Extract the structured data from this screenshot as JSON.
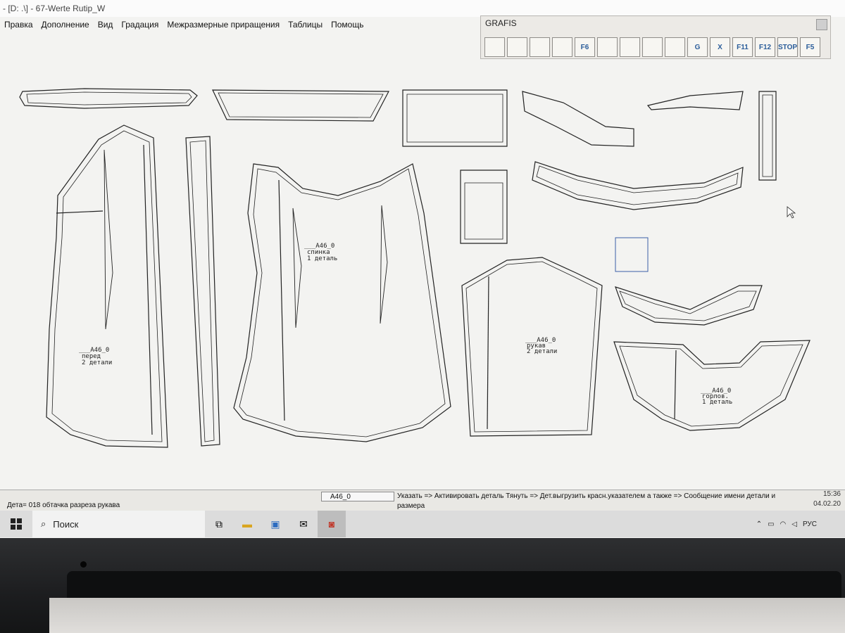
{
  "window": {
    "title": "- [D: .\\] - 67-Werte Rutip_W"
  },
  "menu": [
    "Правка",
    "Дополнение",
    "Вид",
    "Градация",
    "Межразмерные приращения",
    "Таблицы",
    "Помощь"
  ],
  "grafis": {
    "title": "GRAFIS",
    "tools": [
      {
        "icon": "open-folder-icon",
        "text": ""
      },
      {
        "icon": "save-icon",
        "text": ""
      },
      {
        "icon": "print-icon",
        "text": ""
      },
      {
        "icon": "zoom-icon",
        "text": ""
      },
      {
        "icon": "fit-icon",
        "text": "F6"
      },
      {
        "icon": "copy-icon",
        "text": ""
      },
      {
        "icon": "ruler-icon",
        "text": ""
      },
      {
        "icon": "download-icon",
        "text": ""
      },
      {
        "icon": "download-all-icon",
        "text": ""
      },
      {
        "icon": "grading-icon",
        "text": "G"
      },
      {
        "icon": "table-x-icon",
        "text": "X"
      },
      {
        "icon": "f11-icon",
        "text": "F11"
      },
      {
        "icon": "f12-icon",
        "text": "F12"
      },
      {
        "icon": "stop-icon",
        "text": "STOP"
      },
      {
        "icon": "f5-icon",
        "text": "F5"
      }
    ]
  },
  "pieces": {
    "pered": [
      "___A46_0",
      "перед",
      "2 детали"
    ],
    "spinka": [
      "___A46_0",
      "спинка",
      "1 деталь"
    ],
    "rukav": [
      "___A46_0",
      "рукав",
      "2 детали"
    ],
    "gorlovina": [
      "___A46_0",
      "горлов.",
      "1 деталь"
    ]
  },
  "status": {
    "left": "Дета= 018  обтачка разреза рукава",
    "field": "A46_0",
    "hint": "Указать => Активировать деталь Тянуть => Дет.выгрузить красн.указателем а также => Сообщение имени детали и размера"
  },
  "taskbar": {
    "search": "Поиск",
    "lang": "РУС",
    "time": "15:36",
    "date": "04.02.20"
  }
}
